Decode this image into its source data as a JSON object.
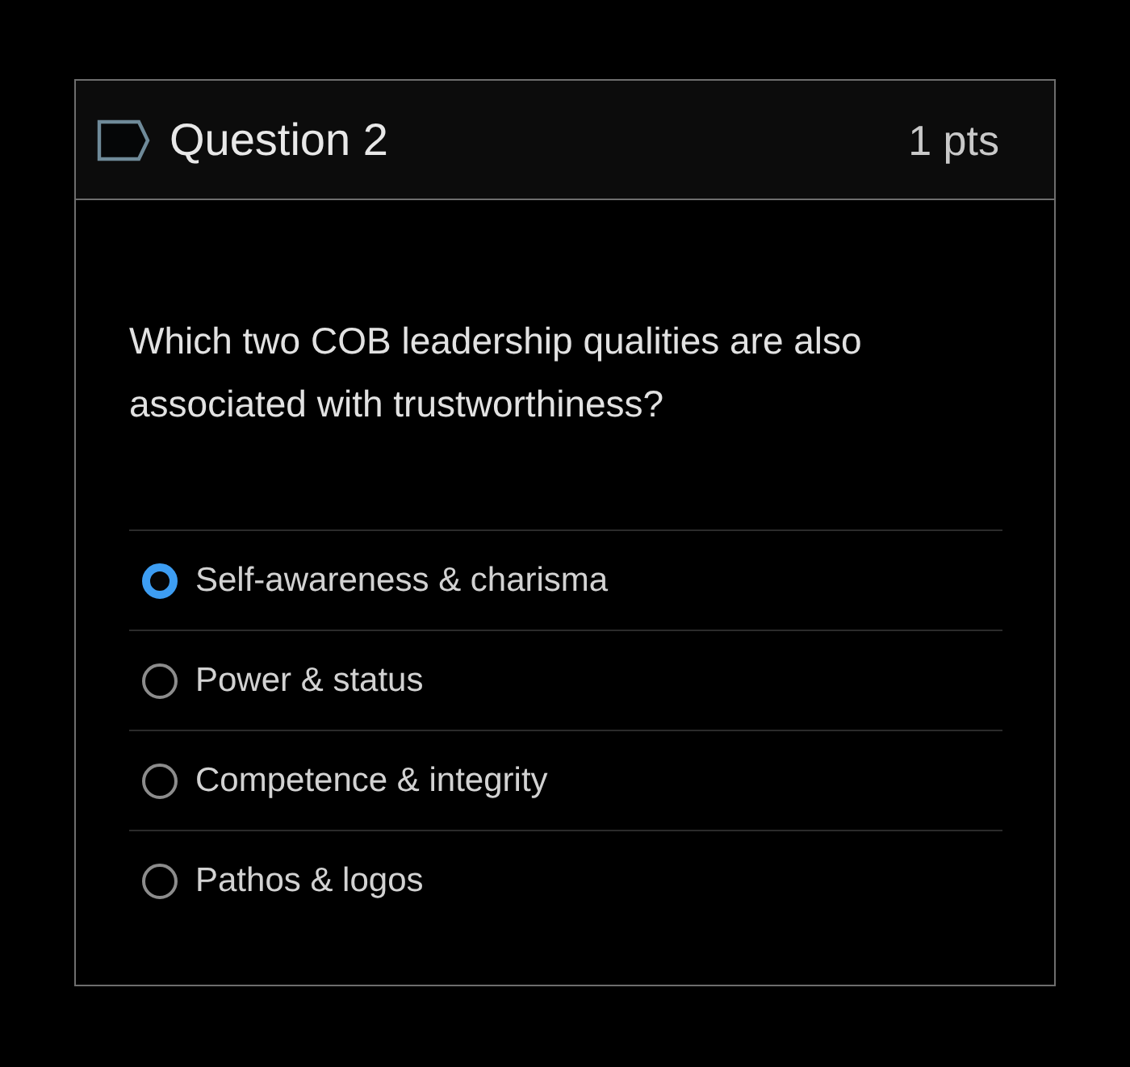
{
  "question": {
    "title": "Question 2",
    "points": "1 pts",
    "text": "Which two COB leadership qualities are also associated with trustworthiness?"
  },
  "answers": [
    {
      "label": "Self-awareness & charisma",
      "selected": true
    },
    {
      "label": "Power & status",
      "selected": false
    },
    {
      "label": "Competence & integrity",
      "selected": false
    },
    {
      "label": "Pathos & logos",
      "selected": false
    }
  ]
}
